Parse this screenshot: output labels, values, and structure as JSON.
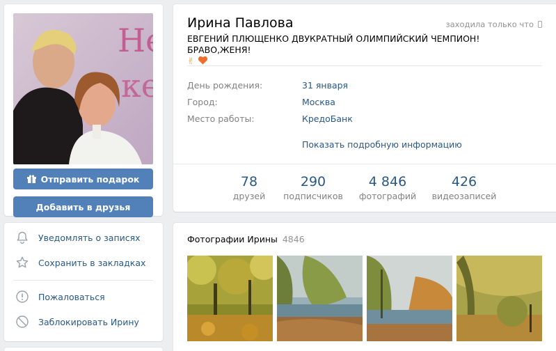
{
  "profile": {
    "name": "Ирина Павлова",
    "online_status": "заходила только что",
    "status_text": "ЕВГЕНИЙ ПЛЮЩЕНКО ДВУКРАТНЫЙ ОЛИМПИЙСКИЙ ЧЕМПИОН! БРАВО,ЖЕНЯ!",
    "status_emoji": "✌",
    "info": [
      {
        "label": "День рождения:",
        "value": "31 января"
      },
      {
        "label": "Город:",
        "value": "Москва"
      },
      {
        "label": "Место работы:",
        "value": "КредоБанк"
      }
    ],
    "more_info_link": "Показать подробную информацию",
    "counters": [
      {
        "value": "78",
        "caption": "друзей"
      },
      {
        "value": "290",
        "caption": "подписчиков"
      },
      {
        "value": "4 846",
        "caption": "фотографий"
      },
      {
        "value": "426",
        "caption": "видеозаписей"
      }
    ]
  },
  "actions": {
    "gift_label": "Отправить подарок",
    "add_friend_label": "Добавить в друзья"
  },
  "menu": {
    "items": [
      {
        "label": "Уведомлять о записях",
        "icon": "bell-icon"
      },
      {
        "label": "Сохранить в закладках",
        "icon": "star-icon"
      },
      {
        "label": "Пожаловаться",
        "icon": "exclamation-icon"
      },
      {
        "label": "Заблокировать Ирину",
        "icon": "block-icon"
      }
    ]
  },
  "photos": {
    "title": "Фотографии Ирины",
    "count": "4846"
  },
  "colors": {
    "accent": "#5181b8",
    "link": "#2a5885",
    "muted": "#828282",
    "background": "#edeef0"
  }
}
